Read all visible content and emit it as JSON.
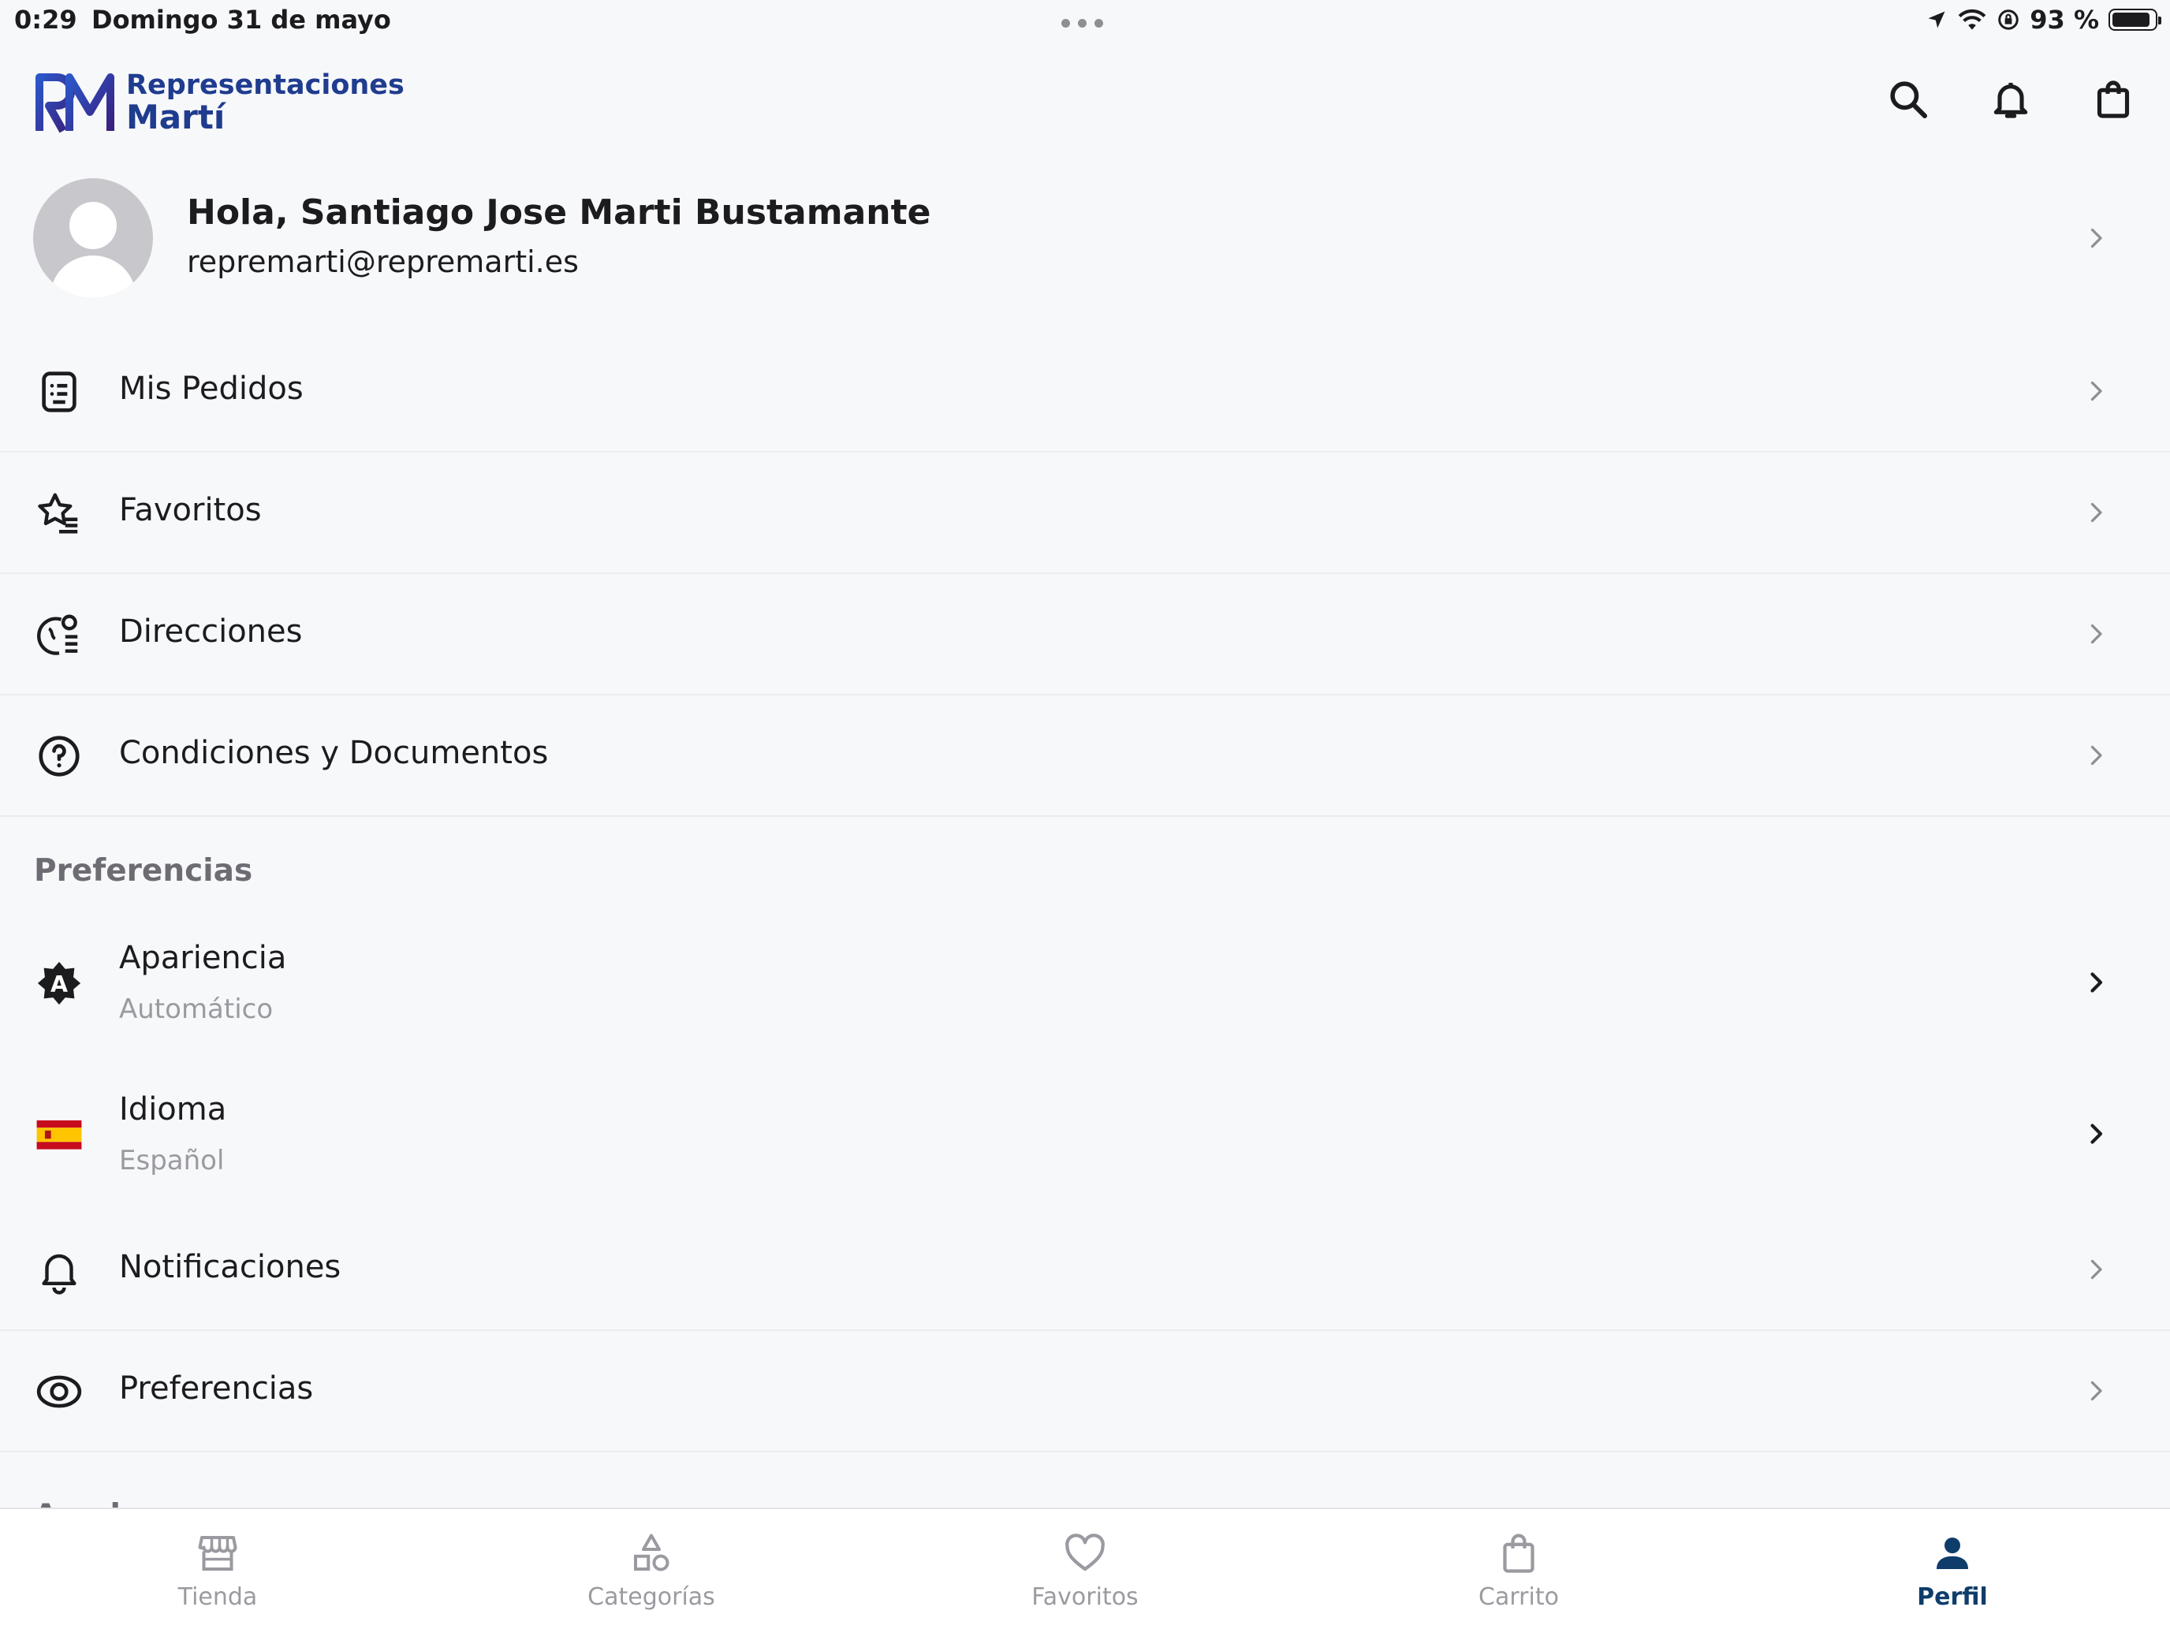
{
  "status_bar": {
    "time": "0:29",
    "date": "Domingo 31 de mayo",
    "battery": "93 %",
    "battery_level_percent": 93
  },
  "header": {
    "brand_line1": "Representaciones",
    "brand_line2": "Martí",
    "icons": [
      "search-icon",
      "bell-icon",
      "shopping-bag-icon"
    ]
  },
  "profile": {
    "greeting": "Hola, Santiago Jose Marti Bustamante",
    "email": "repremarti@repremarti.es"
  },
  "menu": [
    {
      "label": "Mis Pedidos",
      "icon": "receipt-icon"
    },
    {
      "label": "Favoritos",
      "icon": "star-list-icon"
    },
    {
      "label": "Direcciones",
      "icon": "location-list-icon"
    },
    {
      "label": "Condiciones y Documentos",
      "icon": "help-circle-icon"
    }
  ],
  "preferences": {
    "title": "Preferencias",
    "items": [
      {
        "label": "Apariencia",
        "value": "Automático",
        "icon": "appearance-icon"
      },
      {
        "label": "Idioma",
        "value": "Español",
        "icon": "spain-flag-icon"
      },
      {
        "label": "Notificaciones",
        "icon": "bell-icon"
      },
      {
        "label": "Preferencias",
        "icon": "eye-icon"
      }
    ]
  },
  "next_section_title": "Ayuda",
  "tabbar": {
    "tabs": [
      {
        "label": "Tienda",
        "icon": "store-icon",
        "active": false
      },
      {
        "label": "Categorías",
        "icon": "shapes-icon",
        "active": false
      },
      {
        "label": "Favoritos",
        "icon": "heart-icon",
        "active": false
      },
      {
        "label": "Carrito",
        "icon": "bag-icon",
        "active": false
      },
      {
        "label": "Perfil",
        "icon": "person-icon",
        "active": true
      }
    ]
  },
  "colors": {
    "brand": "#1f3c8f",
    "active_tab": "#0f3d6b",
    "background": "#f7f8fa"
  }
}
